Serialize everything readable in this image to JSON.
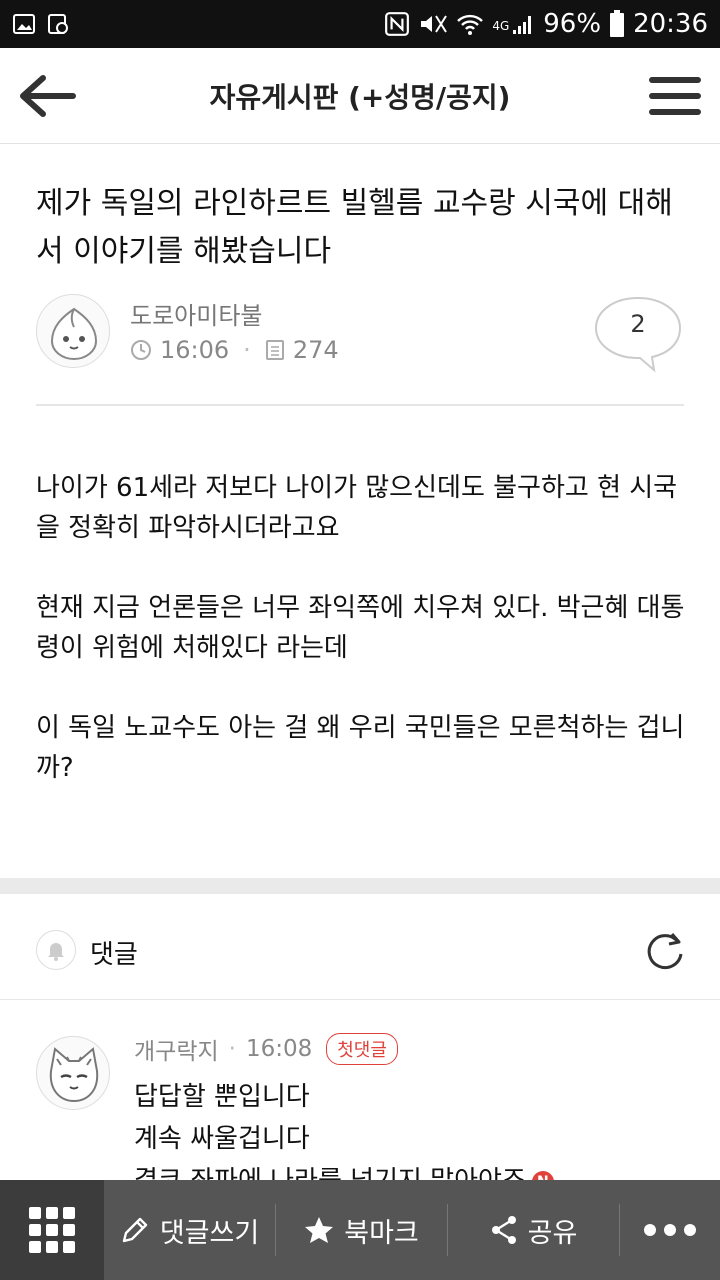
{
  "status_bar": {
    "network": "4G",
    "battery": "96%",
    "time": "20:36"
  },
  "header": {
    "title": "자유게시판 (+성명/공지)"
  },
  "post": {
    "title": "제가 독일의 라인하르트 빌헬름 교수랑 시국에 대해서 이야기를 해봤습니다",
    "author": "도로아미타불",
    "time": "16:06",
    "views": "274",
    "comment_count": "2",
    "body": [
      "나이가 61세라 저보다 나이가 많으신데도 불구하고 현 시국을 정확히 파악하시더라고요",
      "현재 지금 언론들은 너무 좌익쪽에 치우쳐 있다. 박근혜 대통령이 위험에 처해있다 라는데",
      "이 독일 노교수도 아는 걸 왜 우리 국민들은 모른척하는 겁니까?"
    ]
  },
  "comments_section": {
    "label": "댓글"
  },
  "comments": [
    {
      "author": "개구락지",
      "time": "16:08",
      "badge": "첫댓글",
      "lines": [
        "답답할 뿐입니다",
        "계속 싸울겁니다",
        "결코 좌파에 나라를 넘기지 말아야죠"
      ],
      "new_badge": "N"
    }
  ],
  "bottom_bar": {
    "write_comment": "댓글쓰기",
    "bookmark": "북마크",
    "share": "공유"
  }
}
